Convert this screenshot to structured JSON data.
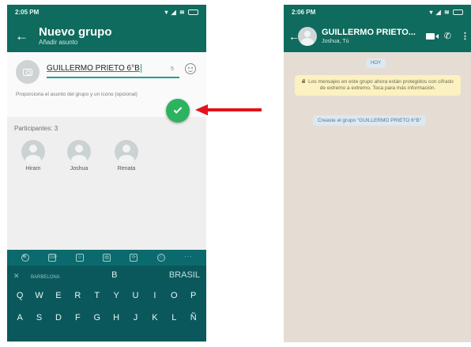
{
  "left": {
    "status": {
      "time": "2:05 PM",
      "icons": "▾ ◢ ≋"
    },
    "appbar": {
      "title": "Nuevo grupo",
      "subtitle": "Añadir asunto"
    },
    "subject": {
      "value": "GUILLERMO PRIETO 6°B",
      "char_count": "5",
      "hint": "Proporciona el asunto del grupo y un icono (opcional)"
    },
    "participants": {
      "label": "Participantes: 3",
      "members": [
        {
          "name": "Hiram"
        },
        {
          "name": "Joshua"
        },
        {
          "name": "Renata"
        }
      ]
    },
    "keyboard": {
      "tools": [
        "🔍",
        "GIF",
        "☺",
        "▤",
        "⟳",
        "ⓘ",
        "···"
      ],
      "suggestions": {
        "close": "✕",
        "left": "BARBELONA",
        "middle": "B",
        "right": "BRASIL"
      },
      "row1": [
        "Q",
        "W",
        "E",
        "R",
        "T",
        "Y",
        "U",
        "I",
        "O",
        "P"
      ],
      "row2": [
        "A",
        "S",
        "D",
        "F",
        "G",
        "H",
        "J",
        "K",
        "L",
        "Ñ"
      ]
    }
  },
  "right": {
    "status": {
      "time": "2:06 PM",
      "icons": "▾ ◢ ≋"
    },
    "chat": {
      "name": "GUILLERMO PRIETO...",
      "members": "Joshua, Tú"
    },
    "day_chip": "HOY",
    "security_note": "Los mensajes en este grupo ahora están protegidos con cifrado de extremo a extremo. Toca para más información.",
    "created_chip": "Creaste el grupo \"GUILLERMO PRIETO 6°B\""
  },
  "colors": {
    "header": "#0f6b5e",
    "accent": "#1aa38c",
    "fab": "#2db35f",
    "arrow": "#e3121b",
    "chat_bg": "#e5ddd4",
    "note_bg": "#fbf1c1"
  }
}
